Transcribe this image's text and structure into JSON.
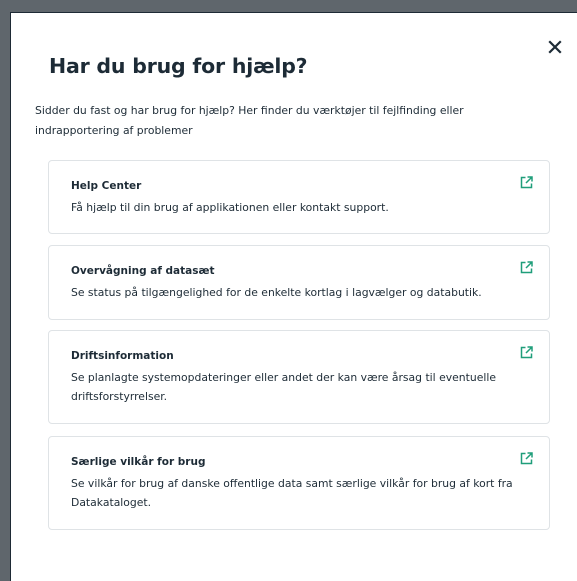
{
  "dialog": {
    "title": "Har du brug for hjælp?",
    "intro": "Sidder du fast og har brug for hjælp? Her finder du værktøjer til fejlfinding eller indrapportering af problemer",
    "close_icon": "close-icon",
    "accent_color": "#1f9e7a"
  },
  "cards": [
    {
      "title": "Help Center",
      "description": "Få hjælp til din brug af applikationen eller kontakt support.",
      "icon": "external-link-icon"
    },
    {
      "title": "Overvågning af datasæt",
      "description": "Se status på tilgængelighed for de enkelte kortlag i lagvælger og databutik.",
      "icon": "external-link-icon"
    },
    {
      "title": "Driftsinformation",
      "description": "Se planlagte systemopdateringer eller andet der kan være årsag til eventuelle driftsforstyrrelser.",
      "icon": "external-link-icon"
    },
    {
      "title": "Særlige vilkår for brug",
      "description": "Se vilkår for brug af danske offentlige data samt særlige vilkår for brug af kort fra Datakataloget.",
      "icon": "external-link-icon"
    }
  ]
}
